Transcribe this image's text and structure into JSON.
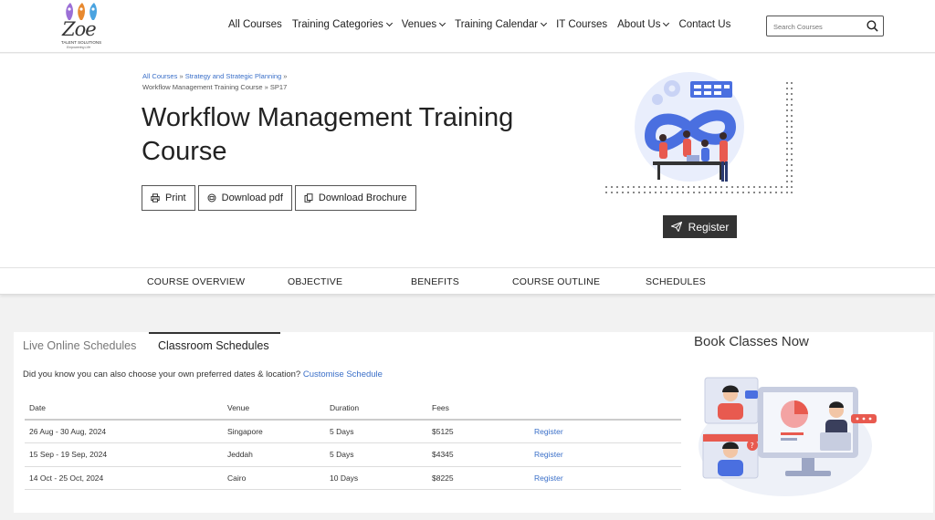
{
  "header": {
    "logo": {
      "brand": "Zoe",
      "sub": "TALENT SOLUTIONS",
      "tagline": "Empowering Life"
    },
    "nav": [
      {
        "label": "All Courses",
        "dropdown": false
      },
      {
        "label": "Training Categories",
        "dropdown": true
      },
      {
        "label": "Venues",
        "dropdown": true
      },
      {
        "label": "Training Calendar",
        "dropdown": true
      },
      {
        "label": "IT Courses",
        "dropdown": false
      },
      {
        "label": "About Us",
        "dropdown": true
      },
      {
        "label": "Contact Us",
        "dropdown": false
      }
    ],
    "search": {
      "placeholder": "Search Courses",
      "icon": "search-icon"
    }
  },
  "hero": {
    "breadcrumb": {
      "items": [
        "All Courses",
        "Strategy and Strategic Planning"
      ],
      "separator": "»",
      "current": "Workflow Management Training Course » SP17"
    },
    "title": "Workflow Management Training Course",
    "buttons": {
      "print": "Print",
      "download_pdf": "Download pdf",
      "download_brochure": "Download Brochure"
    },
    "register": "Register"
  },
  "course_tabs": [
    "COURSE OVERVIEW",
    "OBJECTIVE",
    "BENEFITS",
    "COURSE OUTLINE",
    "SCHEDULES"
  ],
  "schedules": {
    "tabs": {
      "live": "Live Online Schedules",
      "classroom": "Classroom Schedules"
    },
    "hint_text": "Did you know you can also choose your own preferred dates & location?",
    "hint_link": "Customise Schedule",
    "columns": {
      "date": "Date",
      "venue": "Venue",
      "duration": "Duration",
      "fees": "Fees"
    },
    "rows": [
      {
        "date": "26 Aug - 30 Aug, 2024",
        "venue": "Singapore",
        "duration": "5 Days",
        "fees": "$5125",
        "action": "Register"
      },
      {
        "date": "15 Sep - 19 Sep, 2024",
        "venue": "Jeddah",
        "duration": "5 Days",
        "fees": "$4345",
        "action": "Register"
      },
      {
        "date": "14 Oct - 25 Oct, 2024",
        "venue": "Cairo",
        "duration": "10 Days",
        "fees": "$8225",
        "action": "Register"
      }
    ],
    "book_title": "Book Classes Now"
  },
  "colors": {
    "link": "#3a6fc8",
    "dark_button": "#333333",
    "accent_red": "#e85a4f",
    "accent_blue": "#4a6fe0"
  }
}
